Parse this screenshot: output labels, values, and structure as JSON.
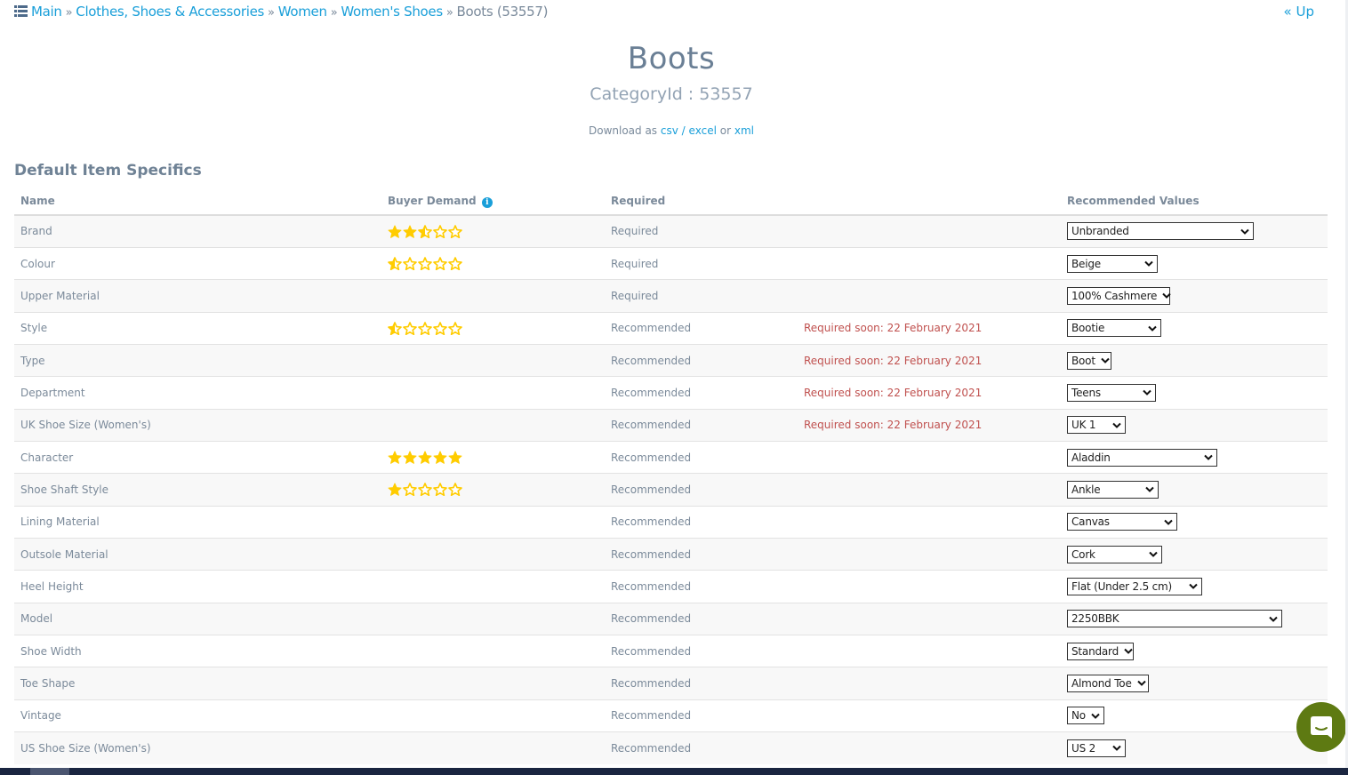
{
  "breadcrumb": {
    "items": [
      "Main",
      "Clothes, Shoes & Accessories",
      "Women",
      "Women's Shoes"
    ],
    "separator": "»",
    "current": "Boots (53557)",
    "icon": "list-icon"
  },
  "up_link": "« Up",
  "title": "Boots",
  "subtitle": "CategoryId : 53557",
  "download": {
    "prefix": "Download as",
    "csv": "csv",
    "slash": "/",
    "excel": "excel",
    "or": "or",
    "xml": "xml"
  },
  "section_title": "Default Item Specifics",
  "table": {
    "headers": {
      "name": "Name",
      "demand": "Buyer Demand",
      "required": "Required",
      "note": "",
      "values": "Recommended Values"
    },
    "rows": [
      {
        "name": "Brand",
        "stars": 2.5,
        "required": "Required",
        "note": "",
        "value": "Unbranded"
      },
      {
        "name": "Colour",
        "stars": 0.5,
        "required": "Required",
        "note": "",
        "value": "Beige"
      },
      {
        "name": "Upper Material",
        "stars": null,
        "required": "Required",
        "note": "",
        "value": "100% Cashmere"
      },
      {
        "name": "Style",
        "stars": 0.5,
        "required": "Recommended",
        "note": "Required soon: 22 February 2021",
        "value": "Bootie"
      },
      {
        "name": "Type",
        "stars": null,
        "required": "Recommended",
        "note": "Required soon: 22 February 2021",
        "value": "Boot"
      },
      {
        "name": "Department",
        "stars": null,
        "required": "Recommended",
        "note": "Required soon: 22 February 2021",
        "value": "Teens"
      },
      {
        "name": "UK Shoe Size (Women's)",
        "stars": null,
        "required": "Recommended",
        "note": "Required soon: 22 February 2021",
        "value": "UK 1"
      },
      {
        "name": "Character",
        "stars": 5,
        "required": "Recommended",
        "note": "",
        "value": "Aladdin"
      },
      {
        "name": "Shoe Shaft Style",
        "stars": 1,
        "required": "Recommended",
        "note": "",
        "value": "Ankle"
      },
      {
        "name": "Lining Material",
        "stars": null,
        "required": "Recommended",
        "note": "",
        "value": "Canvas"
      },
      {
        "name": "Outsole Material",
        "stars": null,
        "required": "Recommended",
        "note": "",
        "value": "Cork"
      },
      {
        "name": "Heel Height",
        "stars": null,
        "required": "Recommended",
        "note": "",
        "value": "Flat (Under 2.5 cm)"
      },
      {
        "name": "Model",
        "stars": null,
        "required": "Recommended",
        "note": "",
        "value": "2250BBK"
      },
      {
        "name": "Shoe Width",
        "stars": null,
        "required": "Recommended",
        "note": "",
        "value": "Standard"
      },
      {
        "name": "Toe Shape",
        "stars": null,
        "required": "Recommended",
        "note": "",
        "value": "Almond Toe"
      },
      {
        "name": "Vintage",
        "stars": null,
        "required": "Recommended",
        "note": "",
        "value": "No"
      },
      {
        "name": "US Shoe Size (Women's)",
        "stars": null,
        "required": "Recommended",
        "note": "",
        "value": "US 2"
      }
    ]
  },
  "chat_widget": {
    "icon": "chat-bubble-icon",
    "color": "#5e7a12"
  },
  "colors": {
    "link": "#1a9fd9",
    "star": "#ffcc00",
    "note": "#c0514f",
    "text": "#7b8a9a"
  }
}
